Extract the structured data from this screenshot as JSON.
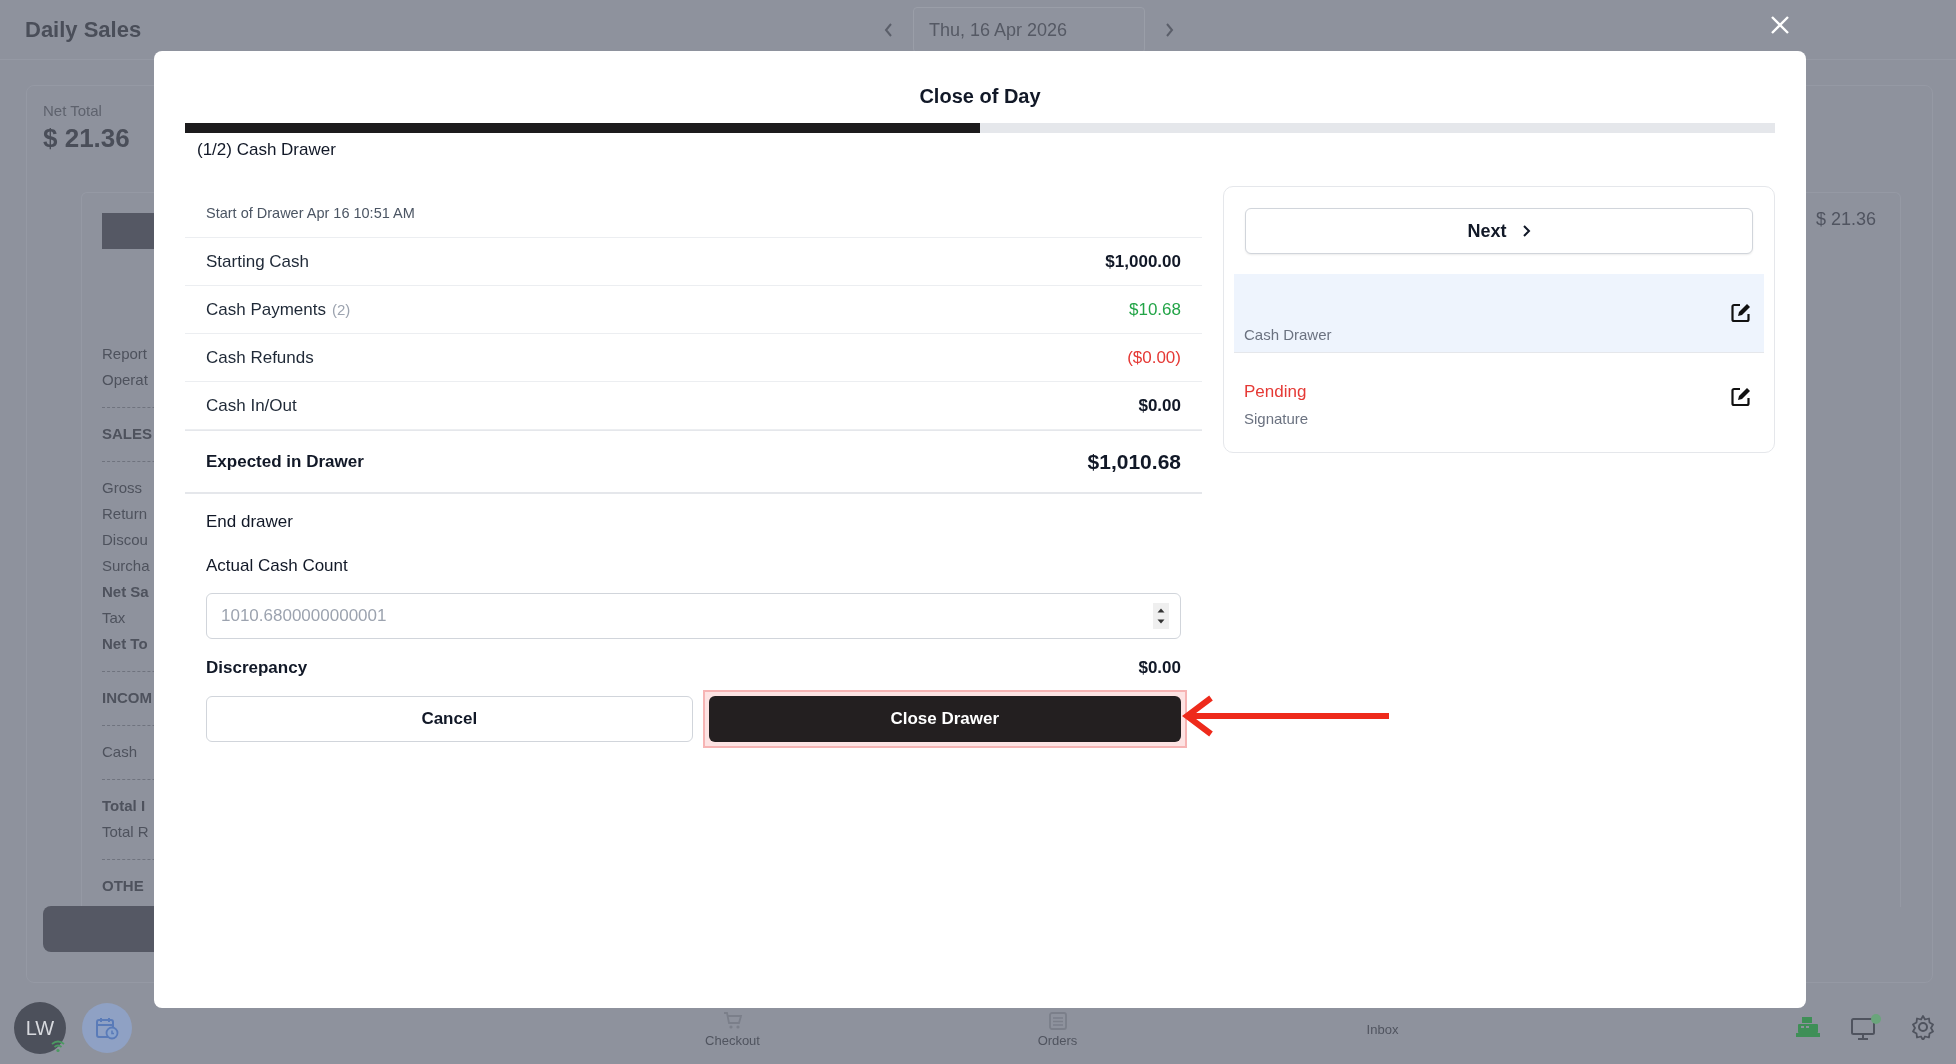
{
  "app": {
    "title": "Daily Sales",
    "date": "Thu, 16 Apr 2026",
    "summary_label": "Net Total",
    "summary_value": "$ 21.36",
    "right_value": "$ 21.36",
    "report_sections": [
      {
        "lines": [
          {
            "text": "Report",
            "bold": false
          },
          {
            "text": "Operat",
            "bold": false
          }
        ]
      },
      {
        "lines": [
          {
            "text": "SALES",
            "bold": true
          }
        ]
      },
      {
        "lines": [
          {
            "text": "Gross",
            "bold": false
          },
          {
            "text": "Return",
            "bold": false
          },
          {
            "text": "Discou",
            "bold": false
          },
          {
            "text": "Surcha",
            "bold": false
          },
          {
            "text": "Net Sa",
            "bold": true
          },
          {
            "text": "Tax",
            "bold": false
          },
          {
            "text": "Net To",
            "bold": true
          }
        ]
      },
      {
        "lines": [
          {
            "text": "INCOM",
            "bold": true
          }
        ]
      },
      {
        "lines": [
          {
            "text": "Cash",
            "bold": false
          }
        ]
      },
      {
        "lines": [
          {
            "text": "Total I",
            "bold": true
          },
          {
            "text": "Total R",
            "bold": false
          }
        ]
      },
      {
        "lines": [
          {
            "text": "OTHE",
            "bold": true
          }
        ]
      }
    ]
  },
  "bottom_bar": {
    "avatar": "LW",
    "nav": [
      "Checkout",
      "Orders",
      "Inbox"
    ]
  },
  "dialog": {
    "title": "Close of Day",
    "progress": {
      "level": 0.5
    },
    "step": "(1/2) Cash Drawer",
    "drawer_start": "Start of Drawer Apr 16 10:51 AM",
    "rows": [
      {
        "label": "Starting Cash",
        "value": "$1,000.00",
        "kind": "normal"
      },
      {
        "label": "Cash Payments",
        "count": "(2)",
        "value": "$10.68",
        "kind": "positive"
      },
      {
        "label": "Cash Refunds",
        "value": "($0.00)",
        "kind": "negative"
      },
      {
        "label": "Cash In/Out",
        "value": "$0.00",
        "kind": "normal"
      }
    ],
    "expected": {
      "label": "Expected in Drawer",
      "value": "$1,010.68"
    },
    "end_heading": "End drawer",
    "count_label": "Actual Cash Count",
    "count_placeholder": "1010.6800000000001",
    "discrepancy": {
      "label": "Discrepancy",
      "value": "$0.00"
    },
    "cancel": "Cancel",
    "confirm": "Close Drawer",
    "next": "Next",
    "steps": [
      {
        "name": "Cash Drawer",
        "selected": true
      },
      {
        "status": "Pending",
        "name": "Signature",
        "selected": false
      }
    ]
  }
}
